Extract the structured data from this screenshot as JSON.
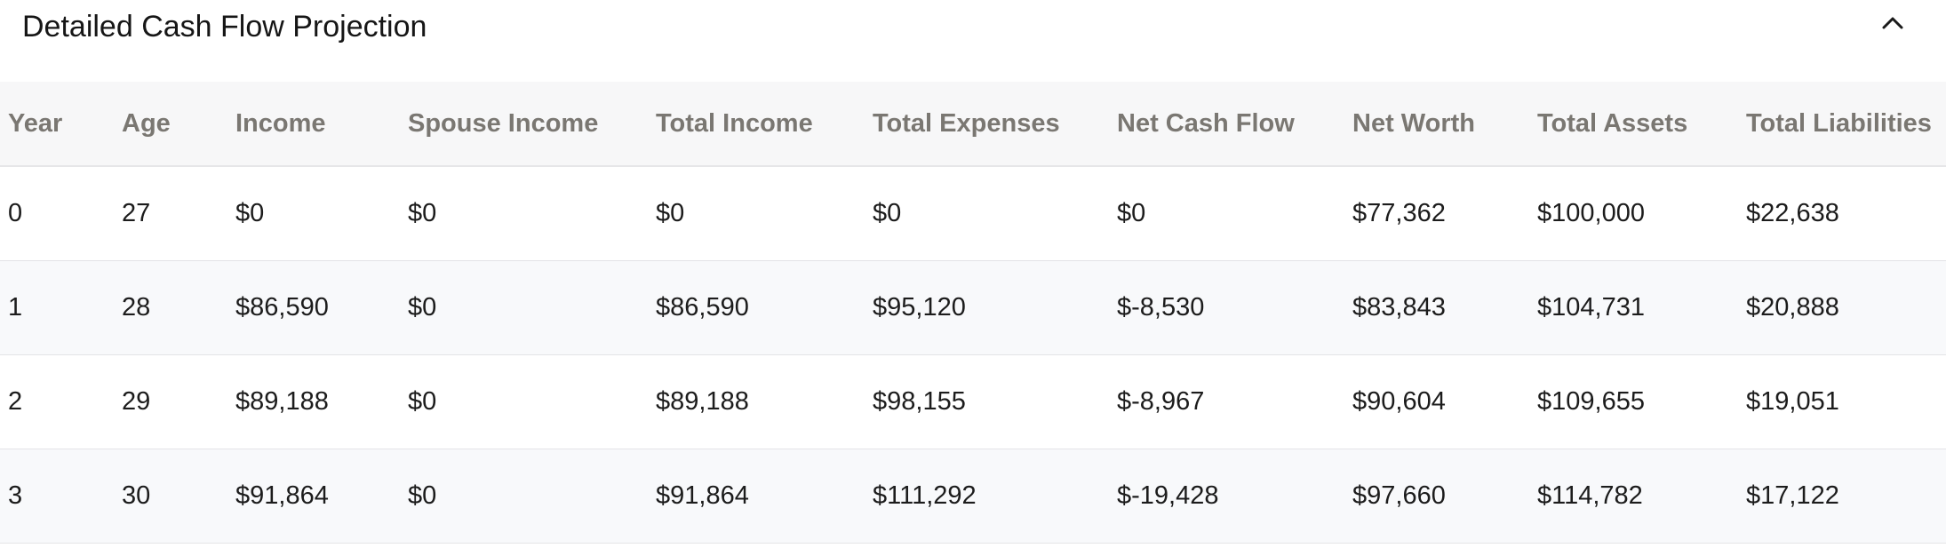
{
  "panel": {
    "title": "Detailed Cash Flow Projection",
    "toggle_icon": "chevron-up-icon"
  },
  "table": {
    "headers": [
      "Year",
      "Age",
      "Income",
      "Spouse Income",
      "Total Income",
      "Total Expenses",
      "Net Cash Flow",
      "Net Worth",
      "Total Assets",
      "Total Liabilities"
    ],
    "rows": [
      [
        "0",
        "27",
        "$0",
        "$0",
        "$0",
        "$0",
        "$0",
        "$77,362",
        "$100,000",
        "$22,638"
      ],
      [
        "1",
        "28",
        "$86,590",
        "$0",
        "$86,590",
        "$95,120",
        "$-8,530",
        "$83,843",
        "$104,731",
        "$20,888"
      ],
      [
        "2",
        "29",
        "$89,188",
        "$0",
        "$89,188",
        "$98,155",
        "$-8,967",
        "$90,604",
        "$109,655",
        "$19,051"
      ],
      [
        "3",
        "30",
        "$91,864",
        "$0",
        "$91,864",
        "$111,292",
        "$-19,428",
        "$97,660",
        "$114,782",
        "$17,122"
      ]
    ]
  },
  "colors": {
    "header_text": "#7a7772",
    "header_bg": "#f7f7f8",
    "row_alt_bg": "#f8f9fb",
    "border": "#e4e4e7",
    "text": "#1c1c1c"
  }
}
